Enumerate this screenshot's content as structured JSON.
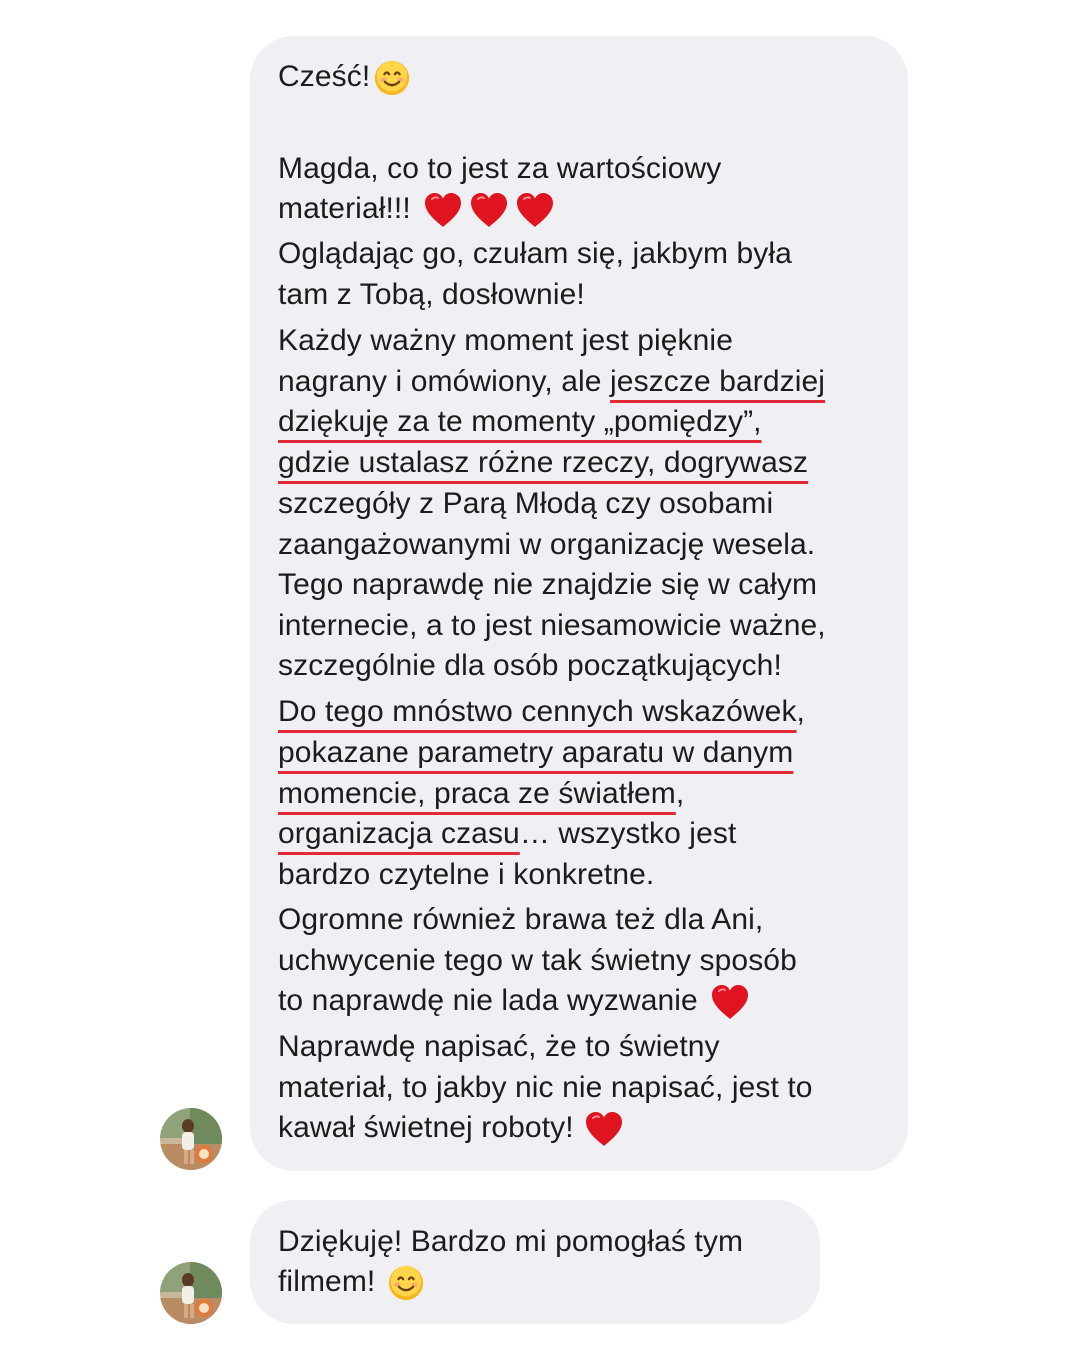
{
  "messages": [
    {
      "lines": [
        "Cześć!",
        "Magda, co to jest za wartościowy",
        "materiał!!!",
        "Oglądając go, czułam się, jakbym była",
        "tam z Tobą, dosłownie!",
        "Każdy ważny moment jest pięknie",
        "nagrany i omówiony, ale ",
        "jeszcze bardziej",
        "dziękuję za te momenty „pomiędzy”,",
        "gdzie ustalasz różne rzeczy, dogrywasz",
        "szczegóły z Parą Młodą czy osobami",
        "zaangażowanymi w organizację wesela.",
        "Tego naprawdę nie znajdzie się w całym",
        "internecie, a to jest niesamowicie ważne,",
        "szczególnie dla osób początkujących!",
        "Do tego mnóstwo cennych wskazówek",
        ",",
        "pokazane parametry aparatu w danym",
        "momencie, praca ze światłem",
        ",",
        "organizacja czasu",
        "… wszystko jest",
        "bardzo czytelne i konkretne.",
        "Ogromne również brawa też dla Ani,",
        "uchwycenie tego w tak świetny sposób",
        "to naprawdę nie lada wyzwanie",
        "Naprawdę napisać, że to świetny",
        "materiał, to jakby nic nie napisać, jest to",
        "kawał świetnej roboty!"
      ],
      "emojis": [
        "smiling-face",
        "red-heart",
        "red-heart",
        "red-heart",
        "red-heart",
        "red-heart"
      ]
    },
    {
      "lines": [
        "Dziękuję! Bardzo mi pomogłaś tym",
        "filmem!"
      ],
      "emojis": [
        "smiling-face"
      ]
    }
  ],
  "colors": {
    "bubble_background": "#efeff4",
    "text": "#1c1c1e",
    "underline": "#e22b37",
    "heart": "#e0141f",
    "smiley": "#f5b81f"
  }
}
